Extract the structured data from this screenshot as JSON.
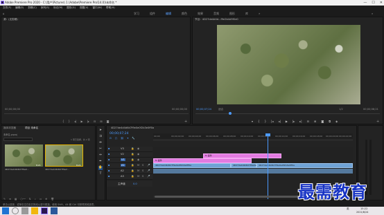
{
  "window": {
    "title": "Adobe Premiere Pro 2020 - C:\\用户\\Pictures\\ 1 (Adobe\\Premiere Pro\\14.0)\\未命名 *",
    "minimize": "—",
    "maximize": "☐",
    "close": "✕"
  },
  "menu": [
    "文件(F)",
    "编辑(E)",
    "剪辑(C)",
    "序列(S)",
    "标记(M)",
    "图形(G)",
    "视图(V)",
    "窗口(W)",
    "帮助(H)"
  ],
  "workspaces": {
    "tabs": [
      "学习",
      "组件",
      "编辑",
      "颜色",
      "效果",
      "音频",
      "图形",
      "库"
    ],
    "active_index": 2,
    "more": "»"
  },
  "source_panel": {
    "title": "源：(无剪辑)",
    "timecode_left": "00;00;00;00",
    "timecode_right": "00;00;00;00",
    "page": "页 1"
  },
  "program_panel": {
    "title": "节目：4D27de4d4d...f9e2b4d9f0e0",
    "timecode": "00;00;07;24",
    "fit_label": "适合",
    "quality": "1/2",
    "duration": "00;00;08;21"
  },
  "project_panel": {
    "tabs": [
      "项目 未命名",
      "媒体浏览器"
    ],
    "active_index": 0,
    "file_name": "未命名.prproj",
    "count": "1 项已选择，共 2 项",
    "items": [
      {
        "name": "4D27de4d4d6d7f9e0...",
        "duration": "8;21"
      },
      {
        "name": "4D27de4d4d6d7f9e2...",
        "duration": "8;21"
      }
    ]
  },
  "timeline": {
    "sequence_tab": "4D27de4d4d6d7f9e0e0f2b3e0ff0a",
    "timecode": "00;00;07;24",
    "ruler": [
      "00;00",
      "00;00;02;00",
      "00;00;04;00",
      "00;00;06;00",
      "00;00;08;00",
      "00;00;10;00",
      "00;00;12;00",
      "00;00;14;00",
      "00;00;16;00",
      "00;00;18;00",
      "00;00;20;00",
      "00;00;22;00",
      "00;00;24;00"
    ],
    "tracks": [
      {
        "label": "V3"
      },
      {
        "label": "V2"
      },
      {
        "label": "V1"
      },
      {
        "label": "A1"
      },
      {
        "label": "A2"
      },
      {
        "label": "A3"
      }
    ],
    "master_label": "主声道",
    "master_value": "0.0",
    "clips": {
      "v2": "fx 画件",
      "v1": "fx 画件",
      "a1_a": "4D27de4d4d6d7f9e0e0f2b3e0ff0a",
      "a1_b": "4D27de4d4d6d7f9e0e0f2b3e0ff0a",
      "a1_c": "4D27de4d4d6d7f9e0e0f2b3e0ff0a"
    }
  },
  "status_bar": "单击以选择，或单击空白处并拖动以进行框选。使用 Shift、Alt 和 Ctrl 可获得其他选项。",
  "taskbar": {
    "time": "15:22",
    "date": "2021/6/24",
    "lang": "英"
  },
  "watermark": "最需教育",
  "colors": {
    "accent_blue": "#4d9bff",
    "video_clip": "#e27ae0",
    "audio_clip": "#6fa3d6",
    "watermark": "#1733c4"
  }
}
